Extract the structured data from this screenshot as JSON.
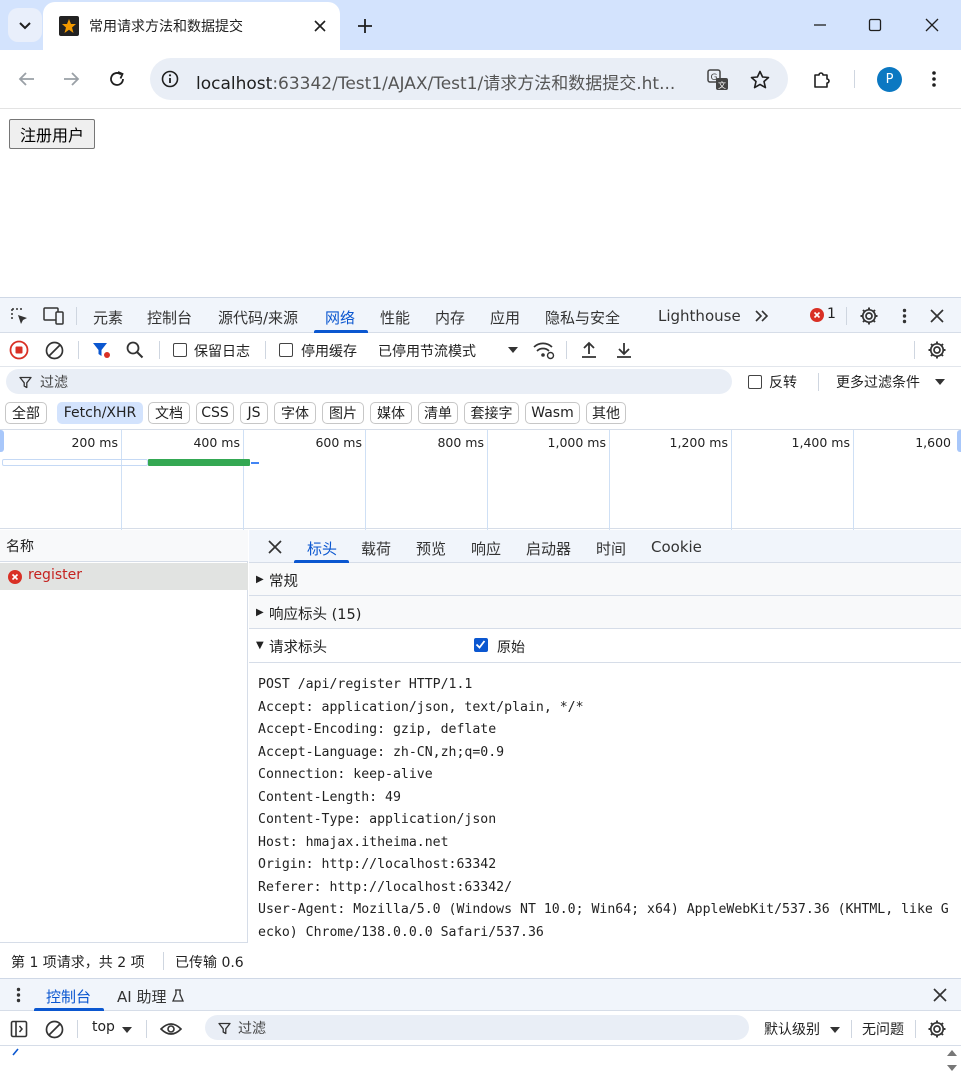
{
  "browser": {
    "tab_title": "常用请求方法和数据提交",
    "url_host": "localhost",
    "url_rest": ":63342/Test1/AJAX/Test1/请求方法和数据提交.ht...",
    "profile_initial": "P"
  },
  "page": {
    "register_button": "注册用户"
  },
  "devtools": {
    "tabs": [
      "元素",
      "控制台",
      "源代码/来源",
      "网络",
      "性能",
      "内存",
      "应用",
      "隐私与安全",
      "Lighthouse"
    ],
    "active_tab": "网络",
    "error_count": "1",
    "network_toolbar": {
      "preserve_log": "保留日志",
      "disable_cache": "停用缓存",
      "throttling": "已停用节流模式"
    },
    "filter": {
      "placeholder": "过滤",
      "invert": "反转",
      "more_filters": "更多过滤条件"
    },
    "type_chips": [
      "全部",
      "Fetch/XHR",
      "文档",
      "CSS",
      "JS",
      "字体",
      "图片",
      "媒体",
      "清单",
      "套接字",
      "Wasm",
      "其他"
    ],
    "active_chip": "Fetch/XHR",
    "timeline_ticks": [
      "200 ms",
      "400 ms",
      "600 ms",
      "800 ms",
      "1,000 ms",
      "1,200 ms",
      "1,400 ms",
      "1,600"
    ],
    "request_list": {
      "header": "名称",
      "rows": [
        {
          "name": "register",
          "status": "error"
        }
      ],
      "status_text": "第 1 项请求，共 2 项",
      "transferred": "已传输 0.6"
    },
    "details": {
      "tabs": [
        "标头",
        "载荷",
        "预览",
        "响应",
        "启动器",
        "时间",
        "Cookie"
      ],
      "active_tab": "标头",
      "sections": {
        "general": "常规",
        "response_headers": "响应标头 (15)",
        "request_headers": "请求标头",
        "raw_label": "原始"
      },
      "raw_lines": [
        "POST /api/register HTTP/1.1",
        "Accept: application/json, text/plain, */*",
        "Accept-Encoding: gzip, deflate",
        "Accept-Language: zh-CN,zh;q=0.9",
        "Connection: keep-alive",
        "Content-Length: 49",
        "Content-Type: application/json",
        "Host: hmajax.itheima.net",
        "Origin: http://localhost:63342",
        "Referer: http://localhost:63342/",
        "User-Agent: Mozilla/5.0 (Windows NT 10.0; Win64; x64) AppleWebKit/537.36 (KHTML, like G",
        "ecko) Chrome/138.0.0.0 Safari/537.36"
      ]
    },
    "drawer": {
      "tabs": [
        "控制台",
        "AI 助理"
      ],
      "context": "top",
      "filter_placeholder": "过滤",
      "log_level": "默认级别",
      "issues": "无问题"
    }
  }
}
